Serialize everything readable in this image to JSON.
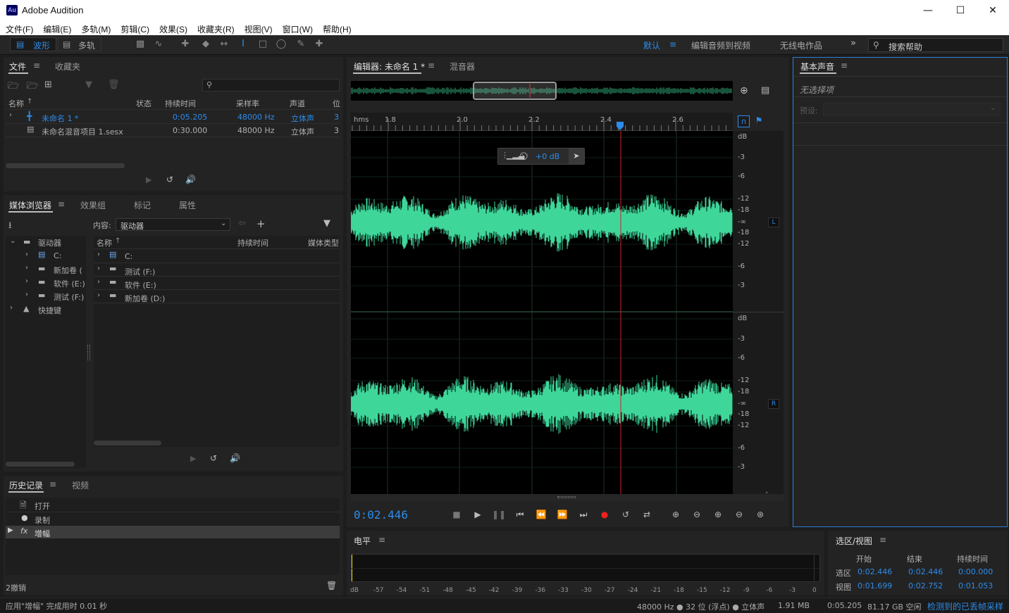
{
  "app": {
    "title": "Adobe Audition",
    "logo": "Au"
  },
  "window_controls": [
    "minimize-icon",
    "maximize-icon",
    "close-icon"
  ],
  "menu": [
    "文件(F)",
    "编辑(E)",
    "多轨(M)",
    "剪辑(C)",
    "效果(S)",
    "收藏夹(R)",
    "视图(V)",
    "窗口(W)",
    "帮助(H)"
  ],
  "toolbar": {
    "waveform": "波形",
    "multitrack": "多轨",
    "workspaces": [
      "默认",
      "编辑音频到视频",
      "无线电作品"
    ],
    "search_placeholder": "搜索帮助"
  },
  "files_panel": {
    "tabs": [
      "文件",
      "收藏夹"
    ],
    "columns": [
      "名称",
      "状态",
      "持续时间",
      "采样率",
      "声道",
      "位"
    ],
    "rows": [
      {
        "name": "未命名 1 *",
        "duration": "0:05.205",
        "rate": "48000 Hz",
        "channels": "立体声",
        "bits": "3"
      },
      {
        "name": "未命名混音项目 1.sesx",
        "duration": "0:30.000",
        "rate": "48000 Hz",
        "channels": "立体声",
        "bits": "3"
      }
    ]
  },
  "media_browser": {
    "tabs": [
      "媒体浏览器",
      "效果组",
      "标记",
      "属性"
    ],
    "content_label": "内容:",
    "content_value": "驱动器",
    "tree": [
      "驱动器",
      "C:",
      "新加卷 (",
      "软件 (E:)",
      "测试 (F:)",
      "快捷键"
    ],
    "columns": [
      "名称",
      "持续时间",
      "媒体类型"
    ],
    "items": [
      "C:",
      "测试 (F:)",
      "软件 (E:)",
      "新加卷 (D:)"
    ]
  },
  "history": {
    "tabs": [
      "历史记录",
      "视频"
    ],
    "items": [
      "打开",
      "录制",
      "增幅"
    ],
    "undo_count": "2撤销"
  },
  "status": {
    "message": "应用\"增幅\" 完成用时 0.01 秒",
    "format": "48000 Hz ● 32 位 (浮点) ● 立体声",
    "size": "1.91 MB",
    "duration": "0:05.205",
    "free": "81.17 GB 空闲",
    "dropped": "检测到的已丢帧采样"
  },
  "editor": {
    "tabs": [
      "编辑器: 未命名 1 *",
      "混音器"
    ],
    "ruler_unit": "hms",
    "ruler_labels": [
      "1.8",
      "2.0",
      "2.2",
      "2.4",
      "2.6"
    ],
    "hud_gain": "+0 dB",
    "db_labels_top": [
      "dB",
      "-3",
      "-6",
      "-12",
      "-18",
      "-∞",
      "-18",
      "-12",
      "-6",
      "-3"
    ],
    "db_labels_bottom": [
      "dB",
      "-3",
      "-6",
      "-12",
      "-18",
      "-∞",
      "-18",
      "-12",
      "-6",
      "-3"
    ],
    "channel_l": "L",
    "channel_r": "R",
    "time": "0:02.446",
    "wave_color": "#3fd69a"
  },
  "essential_sound": {
    "title": "基本声音",
    "no_selection": "无选择项",
    "preset_label": "预设:"
  },
  "levels": {
    "title": "电平",
    "scale": [
      "dB",
      "-57",
      "-54",
      "-51",
      "-48",
      "-45",
      "-42",
      "-39",
      "-36",
      "-33",
      "-30",
      "-27",
      "-24",
      "-21",
      "-18",
      "-15",
      "-12",
      "-9",
      "-6",
      "-3",
      "0"
    ]
  },
  "selection_view": {
    "title": "选区/视图",
    "columns": [
      "开始",
      "结束",
      "持续时间"
    ],
    "rows": [
      {
        "label": "选区",
        "start": "0:02.446",
        "end": "0:02.446",
        "dur": "0:00.000"
      },
      {
        "label": "视图",
        "start": "0:01.699",
        "end": "0:02.752",
        "dur": "0:01.053"
      }
    ]
  }
}
